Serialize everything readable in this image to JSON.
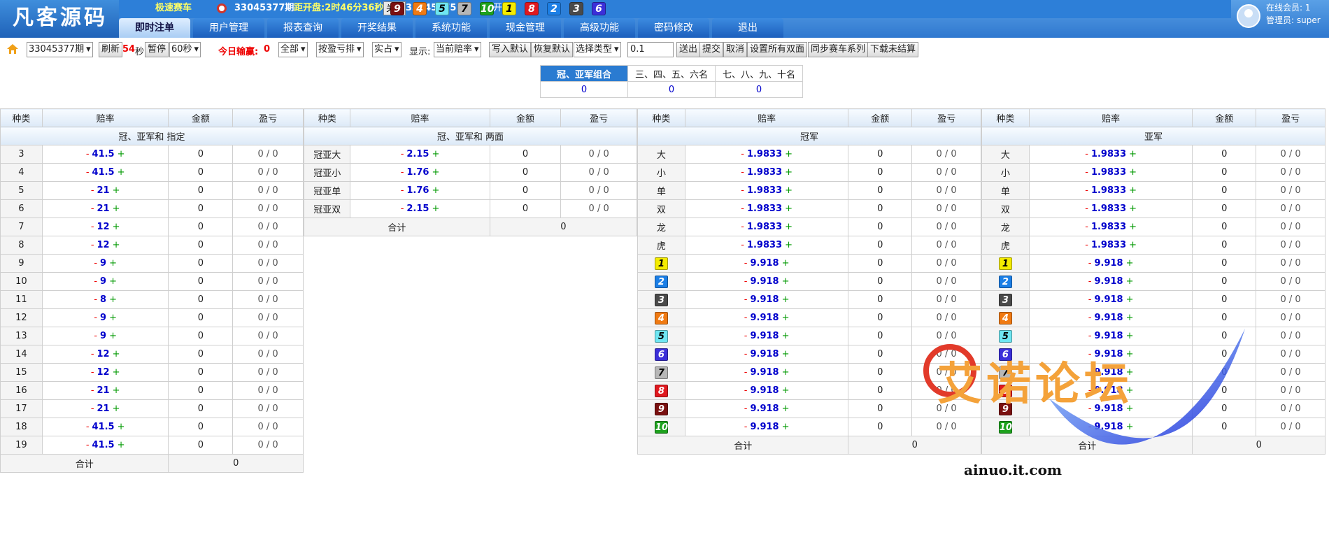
{
  "header": {
    "logo": "凡客源码",
    "game_name": "极速赛车",
    "current_issue": "33045377期",
    "countdown": "距开盘:2时46分36秒",
    "close_label": "关盘",
    "last_issue": "33045375",
    "last_result_label": "期开奖:",
    "result_balls": [
      9,
      4,
      5,
      7,
      10,
      1,
      8,
      2,
      3,
      6
    ],
    "online_label": "在线会员:",
    "online_count": "1",
    "admin_label": "管理员:",
    "admin_name": "super"
  },
  "tabs": [
    "即时注单",
    "用户管理",
    "报表查询",
    "开奖结果",
    "系统功能",
    "现金管理",
    "高级功能",
    "密码修改",
    "退出"
  ],
  "toolbar": {
    "issue_select": "33045377期",
    "refresh": "刷新",
    "seconds": "54",
    "sec_unit": "秒",
    "pause": "暂停",
    "interval": "60秒",
    "today_label": "今日输赢:",
    "today_value": "0",
    "filter_all": "全部",
    "sort": "按盈亏排",
    "actual": "实占",
    "display_label": "显示:",
    "odds_mode": "当前赔率",
    "write_default": "写入默认",
    "restore_default": "恢复默认",
    "select_type": "选择类型",
    "step_value": "0.1",
    "send": "送出",
    "submit": "提交",
    "cancel": "取消",
    "set_all_double": "设置所有双面",
    "sync_series": "同步赛车系列",
    "download_unsettled": "下载未结算"
  },
  "combo": {
    "headers": [
      "冠、亚军组合",
      "三、四、五、六名",
      "七、八、九、十名"
    ],
    "values": [
      "0",
      "0",
      "0"
    ]
  },
  "cols": {
    "kind": "种类",
    "odds": "赔率",
    "amount": "金额",
    "pl": "盈亏"
  },
  "table1": {
    "title": "冠、亚军和 指定",
    "rows": [
      {
        "k": "3",
        "o": "41.5"
      },
      {
        "k": "4",
        "o": "41.5"
      },
      {
        "k": "5",
        "o": "21"
      },
      {
        "k": "6",
        "o": "21"
      },
      {
        "k": "7",
        "o": "12"
      },
      {
        "k": "8",
        "o": "12"
      },
      {
        "k": "9",
        "o": "9"
      },
      {
        "k": "10",
        "o": "9"
      },
      {
        "k": "11",
        "o": "8"
      },
      {
        "k": "12",
        "o": "9"
      },
      {
        "k": "13",
        "o": "9"
      },
      {
        "k": "14",
        "o": "12"
      },
      {
        "k": "15",
        "o": "12"
      },
      {
        "k": "16",
        "o": "21"
      },
      {
        "k": "17",
        "o": "21"
      },
      {
        "k": "18",
        "o": "41.5"
      },
      {
        "k": "19",
        "o": "41.5"
      }
    ],
    "amount": "0",
    "pl": "0 / 0",
    "sum_label": "合计",
    "sum_value": "0"
  },
  "table2": {
    "title": "冠、亚军和 两面",
    "rows": [
      {
        "k": "冠亚大",
        "o": "2.15"
      },
      {
        "k": "冠亚小",
        "o": "1.76"
      },
      {
        "k": "冠亚单",
        "o": "1.76"
      },
      {
        "k": "冠亚双",
        "o": "2.15"
      }
    ],
    "amount": "0",
    "pl": "0 / 0",
    "sum_label": "合计",
    "sum_value": "0"
  },
  "table3": {
    "title": "冠军",
    "text_rows": [
      {
        "k": "大",
        "o": "1.9833"
      },
      {
        "k": "小",
        "o": "1.9833"
      },
      {
        "k": "单",
        "o": "1.9833"
      },
      {
        "k": "双",
        "o": "1.9833"
      },
      {
        "k": "龙",
        "o": "1.9833"
      },
      {
        "k": "虎",
        "o": "1.9833"
      }
    ],
    "ball_odds": "9.918",
    "amount": "0",
    "pl": "0 / 0",
    "sum_label": "合计",
    "sum_value": "0"
  },
  "table4": {
    "title": "亚军",
    "text_rows": [
      {
        "k": "大",
        "o": "1.9833"
      },
      {
        "k": "小",
        "o": "1.9833"
      },
      {
        "k": "单",
        "o": "1.9833"
      },
      {
        "k": "双",
        "o": "1.9833"
      },
      {
        "k": "龙",
        "o": "1.9833"
      },
      {
        "k": "虎",
        "o": "1.9833"
      }
    ],
    "ball_odds": "9.918",
    "amount": "0",
    "pl": "0 / 0",
    "sum_label": "合计",
    "sum_value": "0"
  },
  "ball_colors": {
    "1": "#f4ec00",
    "2": "#1c7fe6",
    "3": "#4a4a4a",
    "4": "#f07a12",
    "5": "#6fe6f2",
    "6": "#3b2fd9",
    "7": "#b7b7b7",
    "8": "#e0191f",
    "9": "#7a1010",
    "10": "#1ea11e"
  },
  "ball_text_colors": {
    "1": "#000",
    "5": "#000",
    "7": "#000"
  },
  "watermark": {
    "title": "艾诺论坛",
    "url": "ainuo.it.com"
  }
}
